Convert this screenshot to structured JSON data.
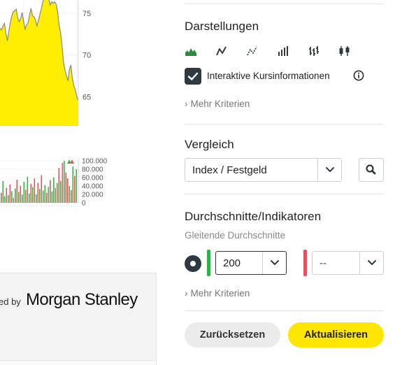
{
  "colors": {
    "price_fill": "#ffee00",
    "price_line": "#888888",
    "volume_up": "#35b544",
    "volume_down": "#e2555a",
    "accent_yellow": "#ffe600",
    "indicator_green": "#2eb34a",
    "indicator_red": "#e5505a",
    "dark": "#2f3a40"
  },
  "chart_data": [
    {
      "type": "area",
      "y_tick_labels": [
        "75",
        "70",
        "65"
      ],
      "y_ticks": [
        75,
        70,
        65
      ],
      "ylim": [
        61.5,
        76.6
      ],
      "x": [
        0,
        1,
        2,
        3,
        4,
        5,
        6,
        7,
        8,
        9,
        10,
        11,
        12,
        13,
        14,
        15,
        16,
        17,
        18,
        19,
        20,
        21,
        22,
        23,
        24,
        25,
        26,
        27,
        28,
        29,
        30,
        31,
        32,
        33,
        34,
        35,
        36,
        37,
        38,
        39,
        40,
        41,
        42,
        43,
        44,
        45,
        46,
        47,
        48,
        49,
        50,
        51,
        52,
        53
      ],
      "values": [
        73.2,
        73.0,
        73.5,
        73.8,
        72.6,
        71.7,
        72.9,
        73.9,
        74.7,
        75.2,
        75.3,
        75.5,
        74.4,
        74.0,
        74.4,
        75.1,
        74.0,
        73.1,
        73.6,
        73.9,
        74.8,
        75.6,
        74.7,
        74.6,
        74.2,
        73.5,
        74.1,
        74.9,
        75.6,
        76.4,
        76.9,
        77.2,
        77.1,
        76.7,
        76.0,
        76.4,
        76.2,
        76.4,
        76.1,
        75.2,
        73.6,
        72.7,
        71.1,
        69.1,
        68.2,
        67.5,
        66.9,
        68.3,
        68.8,
        67.2,
        66.3,
        65.8,
        65.0,
        64.5
      ]
    },
    {
      "type": "bar",
      "y_tick_labels": [
        "100.000",
        "80.000",
        "60.000",
        "40.000",
        "20.000",
        "0"
      ],
      "y_ticks": [
        100000,
        80000,
        60000,
        40000,
        20000,
        0
      ],
      "ylim": [
        0,
        100000
      ],
      "series": [
        {
          "values": [
            24000,
            52000,
            15000,
            36000,
            18000,
            44000,
            28000,
            12000,
            34000,
            55000,
            26000,
            40000,
            19000,
            50000,
            31000,
            62000,
            22000,
            45000,
            37000,
            58000,
            20000,
            48000,
            33000,
            66000,
            29000,
            42000,
            24000,
            38000,
            54000,
            27000,
            60000,
            35000,
            47000,
            83000,
            52000,
            95000,
            100000,
            72000,
            58000,
            40000,
            30000,
            86000,
            64000,
            80000
          ]
        }
      ],
      "bar_colors": [
        "down",
        "up",
        "up",
        "down",
        "up",
        "down",
        "up",
        "down",
        "up",
        "down",
        "up",
        "down",
        "up",
        "up",
        "down",
        "up",
        "up",
        "down",
        "up",
        "down",
        "up",
        "down",
        "up",
        "down",
        "up",
        "up",
        "down",
        "up",
        "down",
        "up",
        "up",
        "down",
        "up",
        "down",
        "up",
        "down",
        "up",
        "down",
        "down",
        "up",
        "down",
        "up",
        "down",
        "up"
      ]
    }
  ],
  "powered_by": {
    "prefix": "ed by",
    "brand": "Morgan Stanley"
  },
  "sections": {
    "darstellungen": {
      "title": "Darstellungen",
      "chart_types": [
        "mountain-chart-icon",
        "line-chart-icon",
        "dot-line-chart-icon",
        "bar-chart-icon",
        "ohlc-chart-icon",
        "candlestick-chart-icon"
      ],
      "interactive_label": "Interaktive Kursinformationen",
      "more": "Mehr Kriterien"
    },
    "vergleich": {
      "title": "Vergleich",
      "select_value": "Index / Festgeld"
    },
    "indikatoren": {
      "title": "Durchschnitte/Indikatoren",
      "ma_label": "Gleitende Durchschnitte",
      "ma1_value": "200",
      "ma2_value": "--",
      "more": "Mehr Kriterien"
    }
  },
  "buttons": {
    "reset": "Zurücksetzen",
    "update": "Aktualisieren"
  }
}
